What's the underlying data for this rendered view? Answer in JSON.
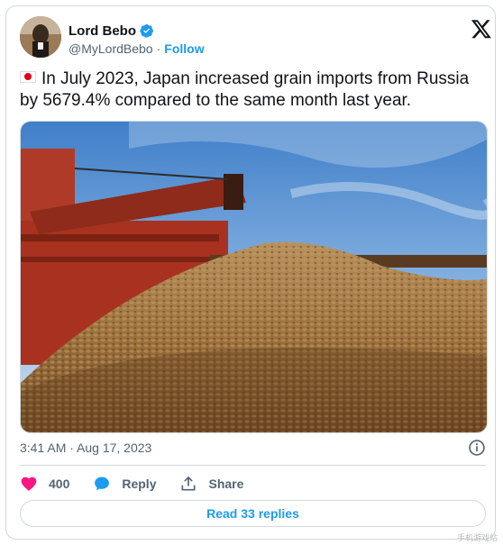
{
  "author": {
    "name": "Lord Bebo",
    "handle": "@MyLordBebo",
    "separator": "·",
    "follow_label": "Follow"
  },
  "tweet": {
    "flag_icon": "japan-flag-emoji",
    "text": "In July 2023, Japan increased grain imports from Russia by 5679.4% compared to the same month last year."
  },
  "media": {
    "description": ""
  },
  "meta": {
    "timestamp": "3:41 AM · Aug 17, 2023"
  },
  "actions": {
    "likes": "400",
    "reply_label": "Reply",
    "share_label": "Share"
  },
  "replies_button": "Read 33 replies",
  "colors": {
    "accent": "#1d9bf0",
    "like": "#f91880",
    "text": "#0f1419",
    "secondary": "#536471",
    "border": "#cfd9de"
  },
  "watermark": "手机游戏站"
}
